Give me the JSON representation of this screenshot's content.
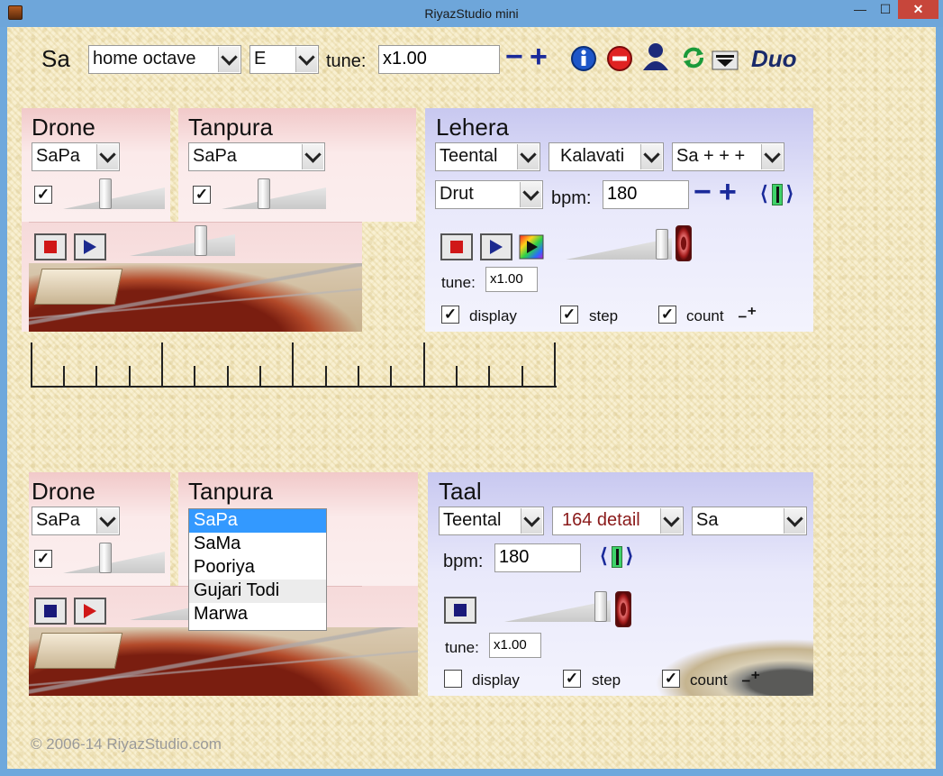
{
  "window": {
    "title": "RiyazStudio mini"
  },
  "top": {
    "sa_label": "Sa",
    "octave": "home octave",
    "key": "E",
    "tune_label": "tune:",
    "tune_value": "x1.00",
    "minus": "−",
    "plus": "+",
    "duo_label": "Duo"
  },
  "upper": {
    "drone": {
      "title": "Drone",
      "preset": "SaPa",
      "enabled": true
    },
    "tanpura": {
      "title": "Tanpura",
      "preset": "SaPa",
      "enabled": true
    },
    "lehera": {
      "title": "Lehera",
      "taal": "Teental",
      "raag": "Kalavati",
      "pitch": "Sa + + +",
      "laya": "Drut",
      "bpm_label": "bpm:",
      "bpm": "180",
      "tune_label": "tune:",
      "tune": "x1.00",
      "display_label": "display",
      "step_label": "step",
      "count_label": "count",
      "display_checked": true,
      "step_checked": true,
      "count_checked": true
    }
  },
  "lower": {
    "drone": {
      "title": "Drone",
      "preset": "SaPa",
      "enabled": true
    },
    "tanpura": {
      "title": "Tanpura",
      "options": [
        "SaPa",
        "SaMa",
        "Pooriya",
        "Gujari Todi",
        "Marwa"
      ],
      "selected": "SaPa"
    },
    "taal": {
      "title": "Taal",
      "taal": "Teental",
      "detail": "164 detail",
      "pitch": "Sa",
      "bpm_label": "bpm:",
      "bpm": "180",
      "tune_label": "tune:",
      "tune": "x1.00",
      "display_label": "display",
      "step_label": "step",
      "count_label": "count",
      "display_checked": false,
      "step_checked": true,
      "count_checked": true
    }
  },
  "footer": {
    "copyright": "© 2006-14 RiyazStudio.com"
  },
  "colors": {
    "accent_blue": "#1a2a9a",
    "pink_panel": "#f1c9c9",
    "blue_panel": "#c8c8f0",
    "list_select": "#3399ff",
    "detail_text": "#8a1a1a"
  }
}
